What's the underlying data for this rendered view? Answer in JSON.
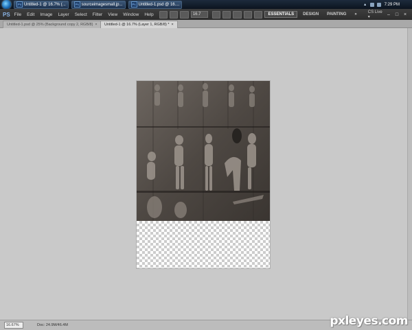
{
  "taskbar": {
    "tasks": [
      {
        "label": "Untitled-1 @ 16.7% (..."
      },
      {
        "label": "sourceimagesmall.jp..."
      },
      {
        "label": "Untitled-1.psd @ 16...."
      }
    ],
    "clock": "7:29 PM"
  },
  "appbar": {
    "logo": "PS",
    "menus": [
      "File",
      "Edit",
      "Image",
      "Layer",
      "Select",
      "Filter",
      "View",
      "Window",
      "Help"
    ],
    "zoom_value": "16.7",
    "workspaces": [
      "ESSENTIALS",
      "DESIGN",
      "PAINTING"
    ],
    "more": "»",
    "cs_live": "CS Live ▾",
    "window_controls": [
      "–",
      "□",
      "×"
    ]
  },
  "tabs": [
    {
      "label": "Untitled-1.psd @ 25% (Background copy 2, RGB/8)",
      "close": "×",
      "active": false
    },
    {
      "label": "Untitled-1 @ 16.7% (Layer 1, RGB/8) *",
      "close": "×",
      "active": true
    }
  ],
  "status": {
    "zoom": "16.67%",
    "doc": "Doc: 24.9M/46.4M"
  },
  "watermark": "pxleyes.com",
  "colors": {
    "app_dark": "#2e2e2e",
    "canvas_gray": "#c9c9c9",
    "taskbar": "#0c141f"
  }
}
